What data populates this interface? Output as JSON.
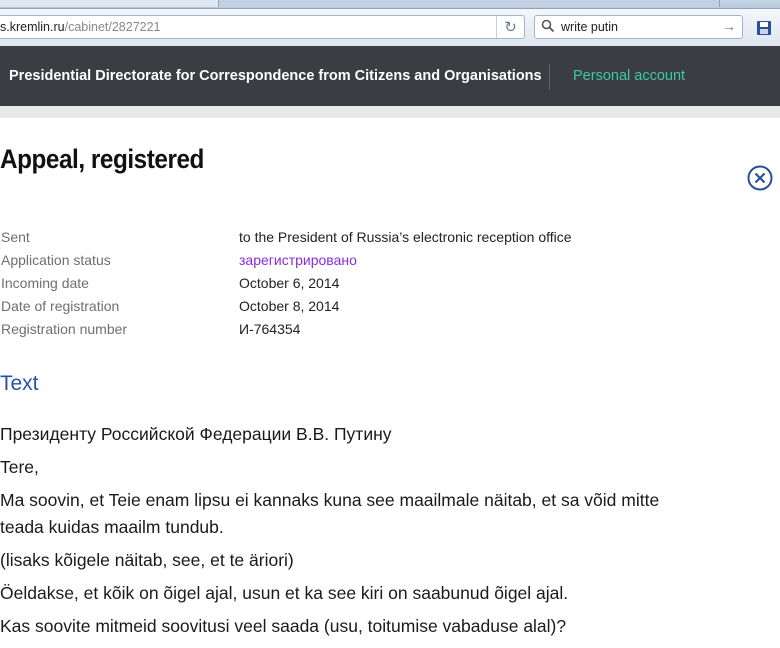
{
  "browser": {
    "url_host": "s.kremlin.ru",
    "url_path": "/cabinet/2827221",
    "search_query": "write putin"
  },
  "header": {
    "site_title": "Presidential Directorate for Correspondence from Citizens and Organisations",
    "personal_account": "Personal account"
  },
  "page": {
    "title": "Appeal, registered"
  },
  "details": [
    {
      "label": "Sent",
      "value": "to the President of Russia’s electronic reception office"
    },
    {
      "label": "Application status",
      "value": "зарегистрировано"
    },
    {
      "label": "Incoming date",
      "value": "October 6, 2014"
    },
    {
      "label": "Date of registration",
      "value": "October 8, 2014"
    },
    {
      "label": "Registration number",
      "value": "И-764354"
    }
  ],
  "text_section": {
    "title": "Text",
    "paragraphs": [
      "Президенту Российской Федерации В.В. Путину",
      "Tere,",
      "Ma soovin, et Teie enam lipsu ei kannaks kuna see maailmale näitab, et sa võid mitte teada kuidas maailm tundub.",
      "(lisaks kõigele näitab, see, et te äriori)",
      "Öeldakse, et kõik on õigel ajal, usun et ka see kiri on saabunud õigel ajal.",
      "Kas soovite mitmeid soovitusi veel saada (usu, toitumise vabaduse alal)?"
    ]
  },
  "colors": {
    "header_bg": "#3a3d42",
    "accent_link": "#3ec8a9",
    "status": "#8a2be2",
    "section_title": "#2850a8"
  }
}
